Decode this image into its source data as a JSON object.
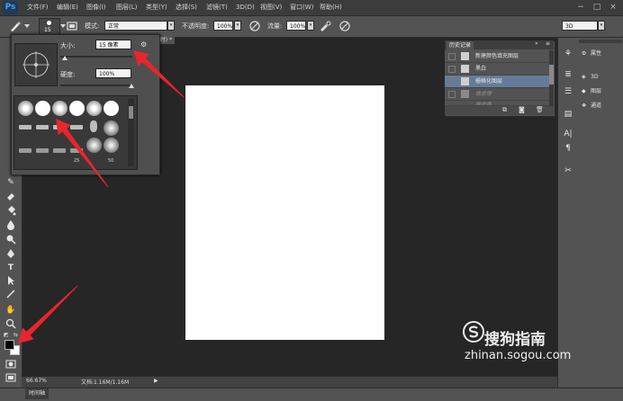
{
  "app": {
    "logo": "Ps"
  },
  "menu": [
    "文件(F)",
    "编辑(E)",
    "图像(I)",
    "图层(L)",
    "类型(Y)",
    "选择(S)",
    "滤镜(T)",
    "3D(D)",
    "视图(V)",
    "窗口(W)",
    "帮助(H)"
  ],
  "window_controls": [
    "−",
    "□",
    "×"
  ],
  "options": {
    "brush_size": "15",
    "mode_label": "模式:",
    "mode_value": "正常",
    "opacity_label": "不透明度:",
    "opacity_value": "100%",
    "flow_label": "流量:",
    "flow_value": "100%",
    "workspace_value": "3D"
  },
  "brush_popup": {
    "size_label": "大小:",
    "size_value": "15 像素",
    "hardness_label": "硬度:",
    "hardness_value": "100%",
    "preset_numbers": [
      "25",
      "50"
    ]
  },
  "document": {
    "tab_title": "@...时) *"
  },
  "history": {
    "title": "历史记录",
    "items": [
      {
        "label": "新建颜色填充图层",
        "active": false,
        "dimmed": false
      },
      {
        "label": "黑白",
        "active": false,
        "dimmed": false
      },
      {
        "label": "栅格化图层",
        "active": true,
        "dimmed": false
      },
      {
        "label": "橡皮擦",
        "active": false,
        "dimmed": true
      },
      {
        "label": "橡皮擦",
        "active": false,
        "dimmed": true
      }
    ]
  },
  "right_panels": [
    {
      "label": "属性",
      "icon": "properties-icon"
    },
    {
      "label": "3D",
      "icon": "3d-icon"
    },
    {
      "label": "图层",
      "icon": "layers-icon"
    },
    {
      "label": "通道",
      "icon": "channels-icon"
    }
  ],
  "status": {
    "zoom": "66.67%",
    "doc_info": "文档:1.16M/1.16M"
  },
  "timeline": {
    "label": "时间轴"
  },
  "colors": {
    "foreground": "#000000",
    "background": "#ffffff",
    "accent": "#e8262b",
    "history_selected": "#667b99"
  },
  "watermark": {
    "brand": "搜狗指南",
    "url": "zhinan.sogou.com"
  }
}
